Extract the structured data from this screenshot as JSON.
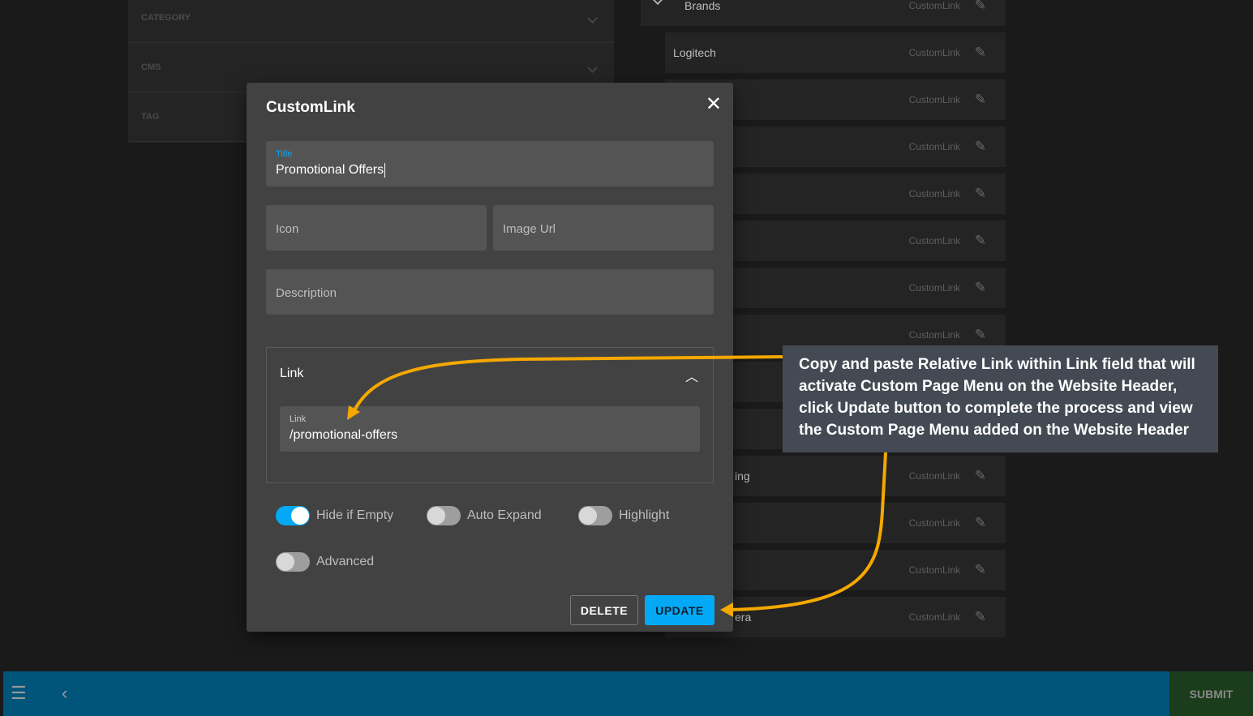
{
  "filters": [
    "CATEGORY",
    "CMS",
    "TAG"
  ],
  "menu_items": [
    {
      "name": "Brands",
      "type": "CustomLink"
    },
    {
      "name": "Logitech",
      "type": "CustomLink"
    },
    {
      "name": "",
      "type": "CustomLink"
    },
    {
      "name": "",
      "type": "CustomLink"
    },
    {
      "name": "",
      "type": "CustomLink"
    },
    {
      "name": "",
      "type": "CustomLink"
    },
    {
      "name": "",
      "type": "CustomLink"
    },
    {
      "name": "",
      "type": "CustomLink"
    },
    {
      "name": "",
      "type": ""
    },
    {
      "name": "",
      "type": ""
    },
    {
      "name": "ing",
      "type": "CustomLink"
    },
    {
      "name": "",
      "type": "CustomLink"
    },
    {
      "name": "",
      "type": "CustomLink"
    },
    {
      "name": "era",
      "type": "CustomLink"
    }
  ],
  "modal": {
    "title": "CustomLink",
    "title_label": "Title",
    "title_value": "Promotional Offers",
    "icon_ph": "Icon",
    "image_ph": "Image Url",
    "desc_ph": "Description",
    "link_section": "Link",
    "link_label": "Link",
    "link_value": "/promotional-offers",
    "toggles": [
      {
        "label": "Hide if Empty",
        "on": true
      },
      {
        "label": "Auto Expand",
        "on": false
      },
      {
        "label": "Highlight",
        "on": false
      },
      {
        "label": "Advanced",
        "on": false
      }
    ],
    "delete": "DELETE",
    "update": "UPDATE"
  },
  "annotation": "Copy and paste Relative Link within Link field that will activate Custom Page Menu on the Website Header, click Update button to complete the process and view the Custom Page Menu added on the Website Header",
  "bottom": {
    "submit": "SUBMIT"
  },
  "colors": {
    "accent": "#03a9f4",
    "arrow": "#f5a800",
    "bar": "#01557b"
  }
}
